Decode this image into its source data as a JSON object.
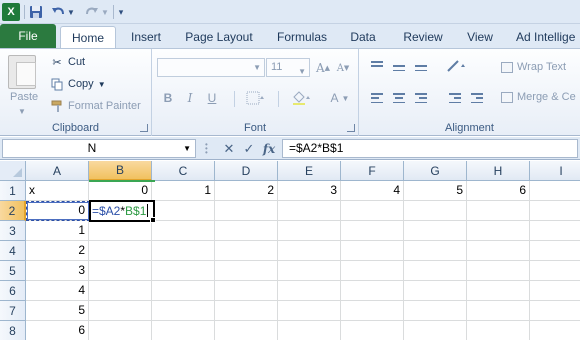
{
  "quick_access": {
    "app_icon": "X",
    "save_icon": "save-icon",
    "undo_icon": "undo-icon",
    "redo_icon": "redo-icon"
  },
  "tabs": {
    "file": "File",
    "home": "Home",
    "insert": "Insert",
    "page_layout": "Page Layout",
    "formulas": "Formulas",
    "data": "Data",
    "review": "Review",
    "view": "View",
    "addins": "Ad Intellige"
  },
  "ribbon": {
    "clipboard": {
      "label": "Clipboard",
      "paste": "Paste",
      "cut": "Cut",
      "copy": "Copy",
      "format_painter": "Format Painter"
    },
    "font": {
      "label": "Font",
      "name": "",
      "size": "11",
      "grow": "A",
      "shrink": "A",
      "bold": "B",
      "italic": "I",
      "underline": "U",
      "fill": "A",
      "font_color": "A"
    },
    "alignment": {
      "label": "Alignment",
      "wrap_text": "Wrap Text",
      "merge_center": "Merge & Ce"
    }
  },
  "formula_bar": {
    "name_box": "N",
    "cancel": "✕",
    "enter": "✓",
    "fx": "fx",
    "formula": "=$A2*B$1"
  },
  "grid": {
    "columns": [
      "A",
      "B",
      "C",
      "D",
      "E",
      "F",
      "G",
      "H",
      "I"
    ],
    "rows": [
      "1",
      "2",
      "3",
      "4",
      "5",
      "6",
      "7",
      "8"
    ],
    "selected_column": "B",
    "selected_row": "2",
    "cells": {
      "A1": "x",
      "B1": "0",
      "C1": "1",
      "D1": "2",
      "E1": "3",
      "F1": "4",
      "G1": "5",
      "H1": "6",
      "A2": "0",
      "A3": "1",
      "A4": "2",
      "A5": "3",
      "A6": "4",
      "A7": "5",
      "A8": "6"
    },
    "editing_cell": {
      "ref_a": "=$A2",
      "op": "*",
      "ref_b": "B$1"
    }
  },
  "colors": {
    "file_tab": "#2b7a3f",
    "header_selected": "#f1c15f",
    "ref_a_color": "#2b4fa8",
    "ref_b_color": "#2e9a44"
  }
}
